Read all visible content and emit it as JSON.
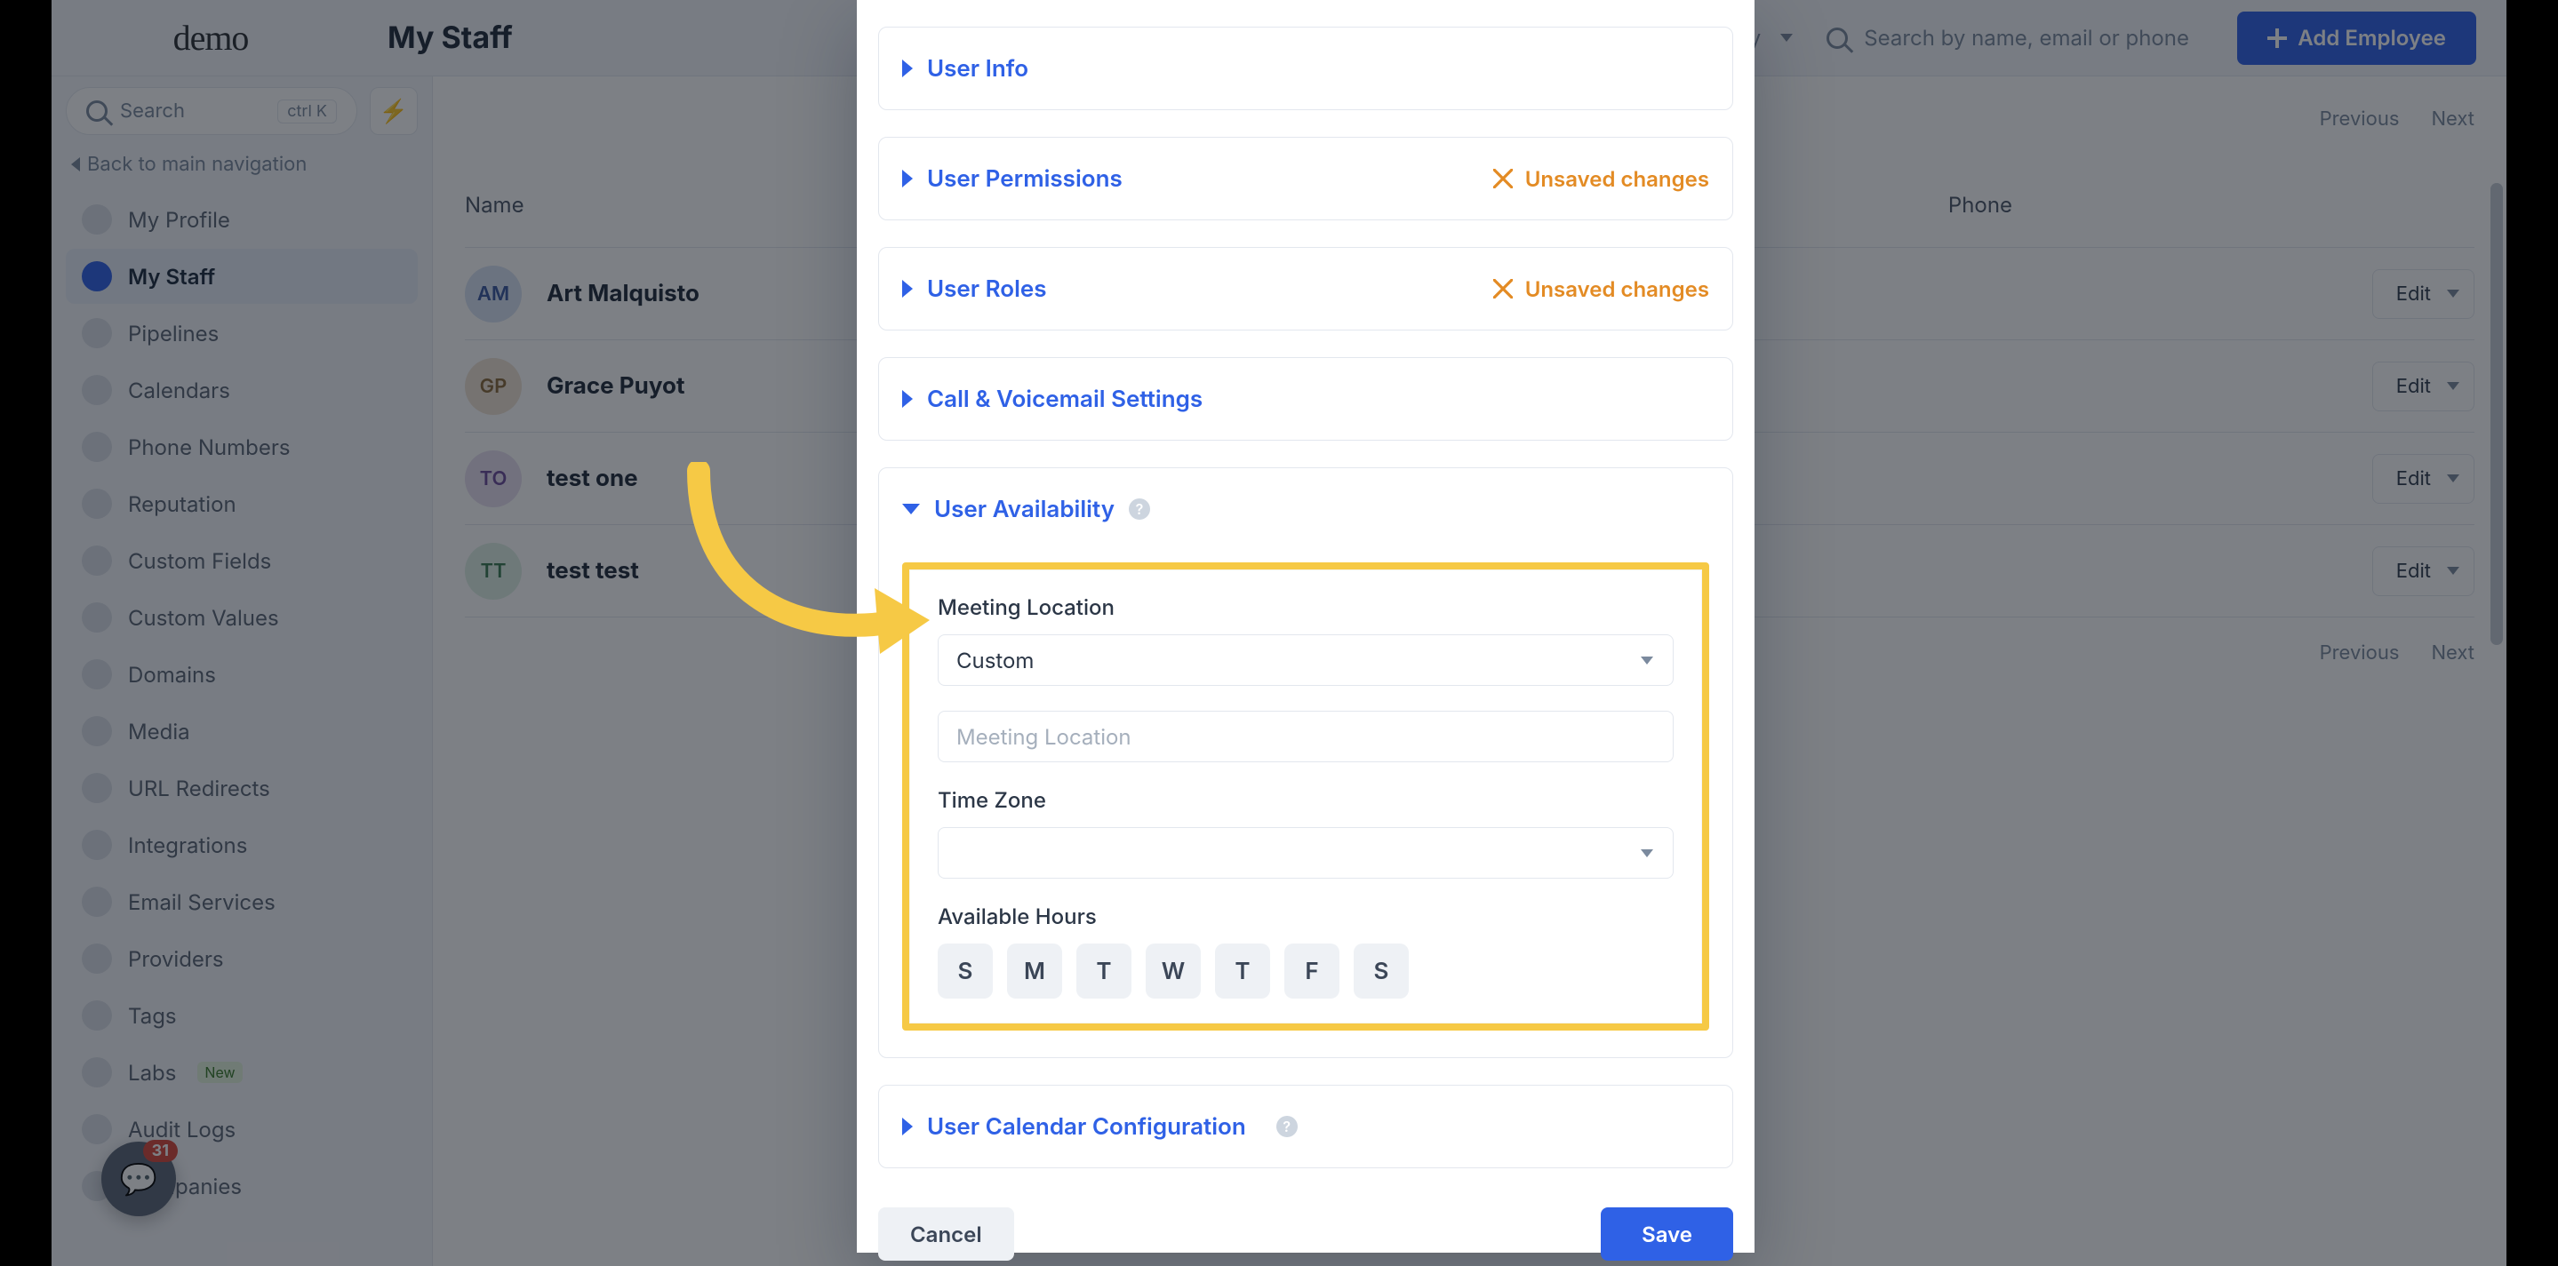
{
  "brand": "demo",
  "page_title": "My Staff",
  "topbar": {
    "filter_label": "by",
    "search_placeholder": "Search by name, email or phone",
    "add_button": "Add Employee"
  },
  "sidebar": {
    "search_placeholder": "Search",
    "search_kbd": "ctrl K",
    "back_label": "Back to main navigation",
    "items": [
      {
        "label": "My Profile"
      },
      {
        "label": "My Staff"
      },
      {
        "label": "Pipelines"
      },
      {
        "label": "Calendars"
      },
      {
        "label": "Phone Numbers"
      },
      {
        "label": "Reputation"
      },
      {
        "label": "Custom Fields"
      },
      {
        "label": "Custom Values"
      },
      {
        "label": "Domains"
      },
      {
        "label": "Media"
      },
      {
        "label": "URL Redirects"
      },
      {
        "label": "Integrations"
      },
      {
        "label": "Email Services"
      },
      {
        "label": "Providers"
      },
      {
        "label": "Tags"
      },
      {
        "label": "Labs"
      },
      {
        "label": "Audit Logs"
      },
      {
        "label": "Companies"
      }
    ],
    "labs_pill": "New"
  },
  "table": {
    "cols": {
      "name": "Name",
      "phone": "Phone"
    },
    "nav": {
      "prev": "Previous",
      "next": "Next"
    },
    "edit_label": "Edit",
    "rows": [
      {
        "initials": "AM",
        "name": "Art Malquisto"
      },
      {
        "initials": "GP",
        "name": "Grace Puyot"
      },
      {
        "initials": "TO",
        "name": "test one"
      },
      {
        "initials": "TT",
        "name": "test test"
      }
    ]
  },
  "fab_badge": "31",
  "modal": {
    "sections": {
      "user_info": "User Info",
      "user_permissions": "User Permissions",
      "user_roles": "User Roles",
      "call_voicemail": "Call & Voicemail Settings",
      "user_availability": "User Availability",
      "user_calendar": "User Calendar Configuration"
    },
    "unsaved": "Unsaved changes",
    "availability": {
      "meeting_location_label": "Meeting Location",
      "meeting_location_value": "Custom",
      "meeting_location_placeholder": "Meeting Location",
      "timezone_label": "Time Zone",
      "timezone_value": "",
      "available_hours_label": "Available Hours",
      "days": [
        "S",
        "M",
        "T",
        "W",
        "T",
        "F",
        "S"
      ]
    },
    "actions": {
      "cancel": "Cancel",
      "save": "Save"
    }
  }
}
